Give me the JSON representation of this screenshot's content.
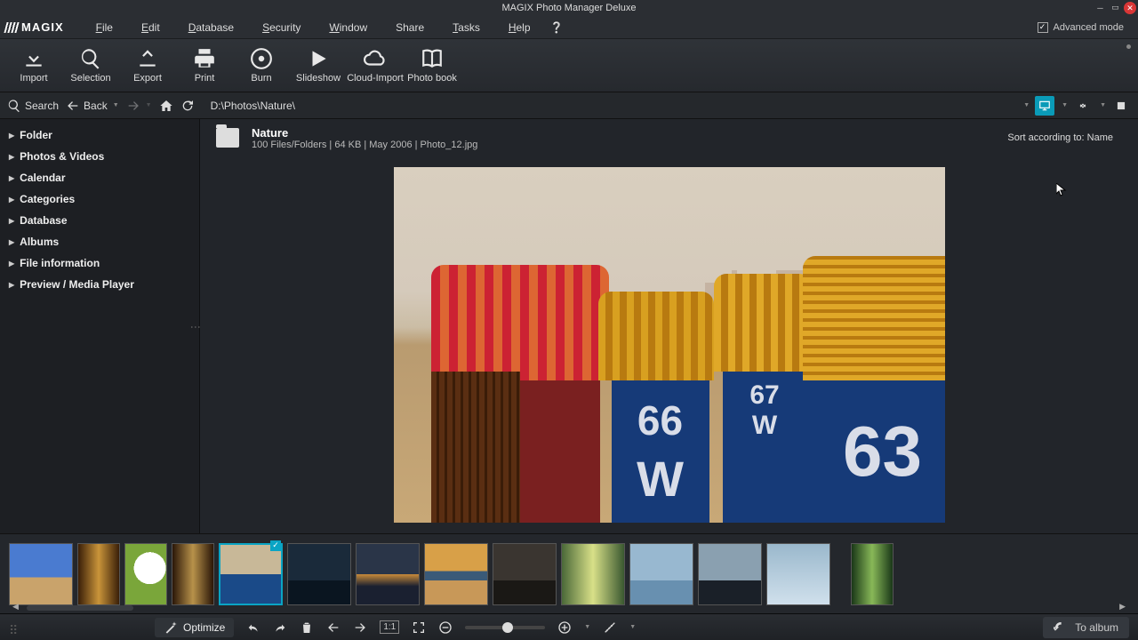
{
  "title": "MAGIX Photo Manager Deluxe",
  "logo": "MAGIX",
  "menu": {
    "file": "File",
    "edit": "Edit",
    "database": "Database",
    "security": "Security",
    "window": "Window",
    "share": "Share",
    "tasks": "Tasks",
    "help": "Help"
  },
  "advanced_mode": "Advanced mode",
  "toolbar": {
    "import": "Import",
    "selection": "Selection",
    "export": "Export",
    "print": "Print",
    "burn": "Burn",
    "slideshow": "Slideshow",
    "cloud": "Cloud-Import",
    "photobook": "Photo book"
  },
  "nav": {
    "search": "Search",
    "back": "Back",
    "path": "D:\\Photos\\Nature\\"
  },
  "sidebar": {
    "items": [
      "Folder",
      "Photos & Videos",
      "Calendar",
      "Categories",
      "Database",
      "Albums",
      "File information",
      "Preview / Media Player"
    ]
  },
  "folder": {
    "name": "Nature",
    "meta": "100 Files/Folders | 64 KB | May 2006 | Photo_12.jpg",
    "sort": "Sort according to: Name"
  },
  "chairs": {
    "c2_num": "66",
    "c2_w": "W",
    "c3_num": "67",
    "c3_w": "W",
    "c4_num": "63"
  },
  "bottom": {
    "optimize": "Optimize",
    "fit": "1:1",
    "to_album": "To album"
  }
}
